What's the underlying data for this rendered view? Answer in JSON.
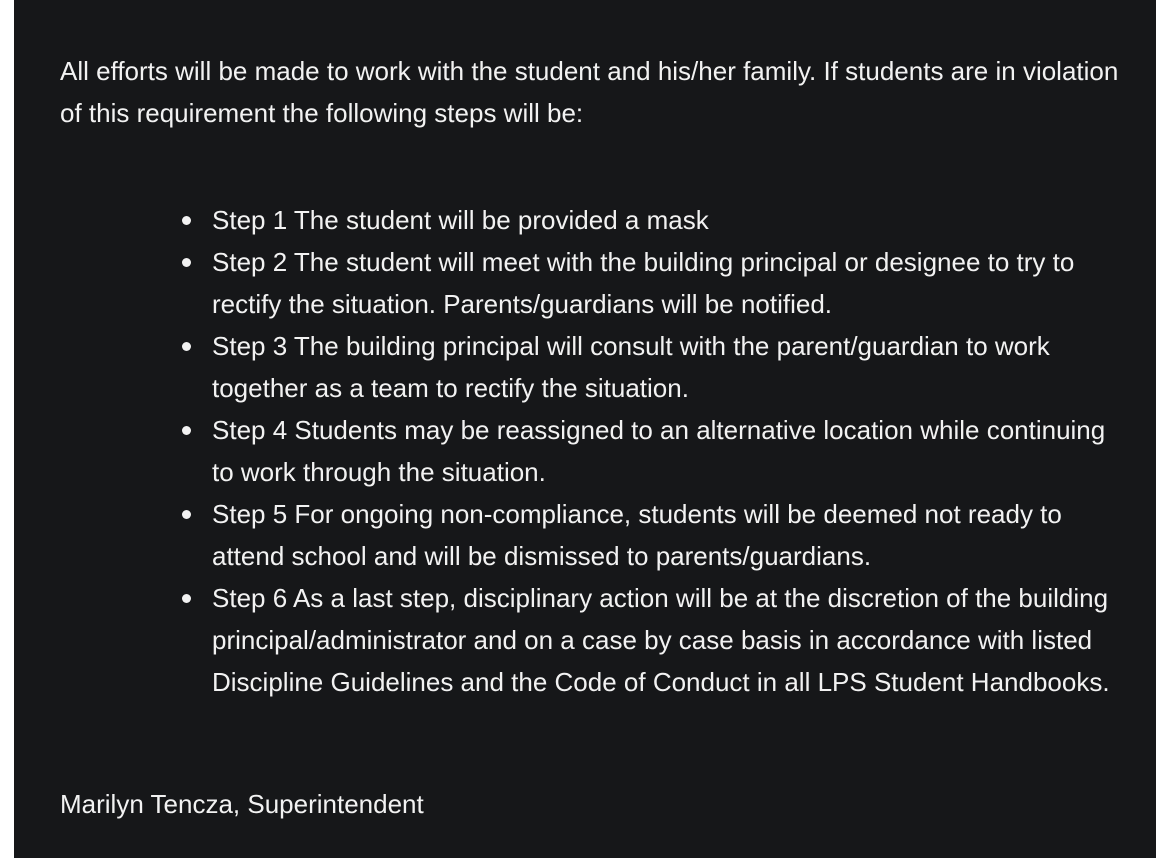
{
  "intro_text": "All efforts will be made to work with the student and his/her family. If students are in violation of this requirement the following steps will be:",
  "steps": [
    "Step 1 The student will be provided a mask",
    "Step 2 The student will meet with the building principal or designee to try to rectify the situation. Parents/guardians will be notified.",
    "Step 3 The building principal will consult with the parent/guardian to work together as a team to rectify the situation.",
    "Step 4 Students may be reassigned to an alternative location while continuing to work through the situation.",
    "Step 5 For ongoing non-compliance, students will be deemed not ready to attend school and will be dismissed to parents/guardians.",
    "Step 6 As a last step, disciplinary action will be at the discretion of the building principal/administrator and on a case by case basis in accordance with listed Discipline Guidelines and the Code of Conduct in all LPS Student Handbooks."
  ],
  "signature": "Marilyn Tencza, Superintendent"
}
